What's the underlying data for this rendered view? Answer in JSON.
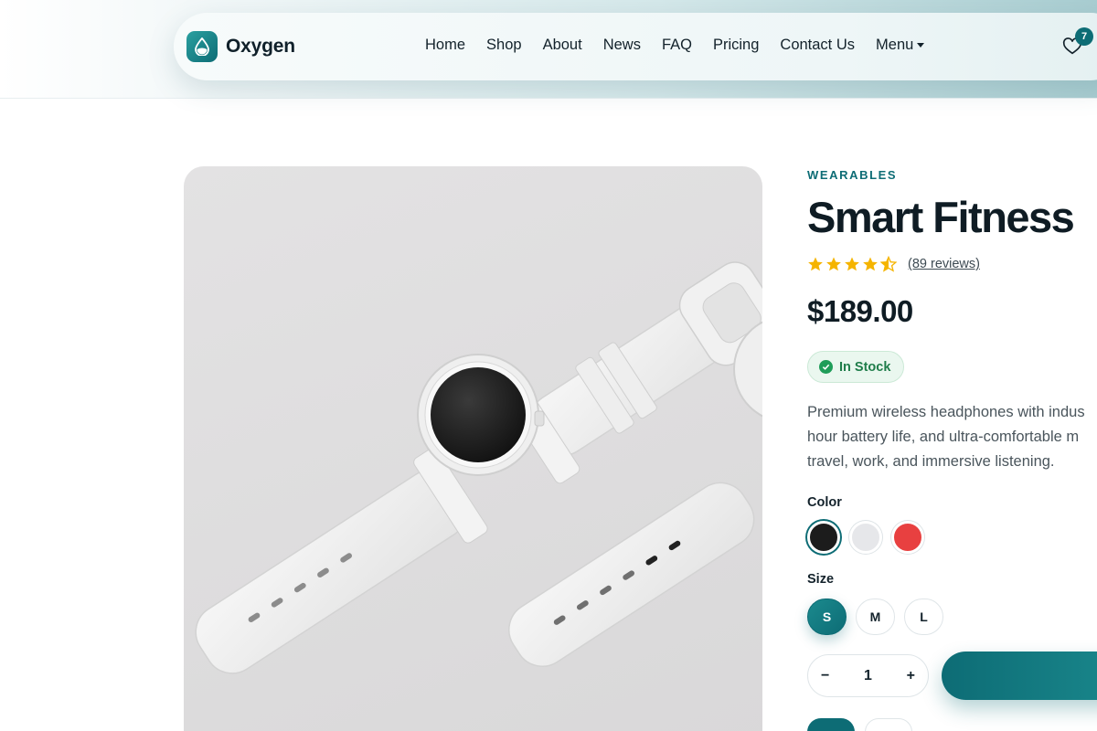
{
  "brand": {
    "name": "Oxygen"
  },
  "nav": {
    "items": [
      "Home",
      "Shop",
      "About",
      "News",
      "FAQ",
      "Pricing",
      "Contact Us"
    ],
    "menu_label": "Menu"
  },
  "wishlist": {
    "count": "7"
  },
  "product": {
    "category": "WEARABLES",
    "title": "Smart Fitness",
    "rating": 4.5,
    "reviews": "(89 reviews)",
    "price": "$189.00",
    "stock": "In Stock",
    "description_lines": [
      "Premium wireless headphones with indus",
      "hour battery life, and ultra-comfortable m",
      "travel, work, and immersive listening."
    ],
    "color_label": "Color",
    "colors": [
      "#1c1c1c",
      "#e6e7ea",
      "#e84040"
    ],
    "selected_color_index": 0,
    "size_label": "Size",
    "sizes": [
      "S",
      "M",
      "L"
    ],
    "selected_size_index": 0,
    "quantity": "1",
    "qty_minus": "−",
    "qty_plus": "+"
  },
  "theme": {
    "accent": "#0d6c75",
    "star": "#f5b400",
    "stock_green": "#1f7d4a"
  }
}
